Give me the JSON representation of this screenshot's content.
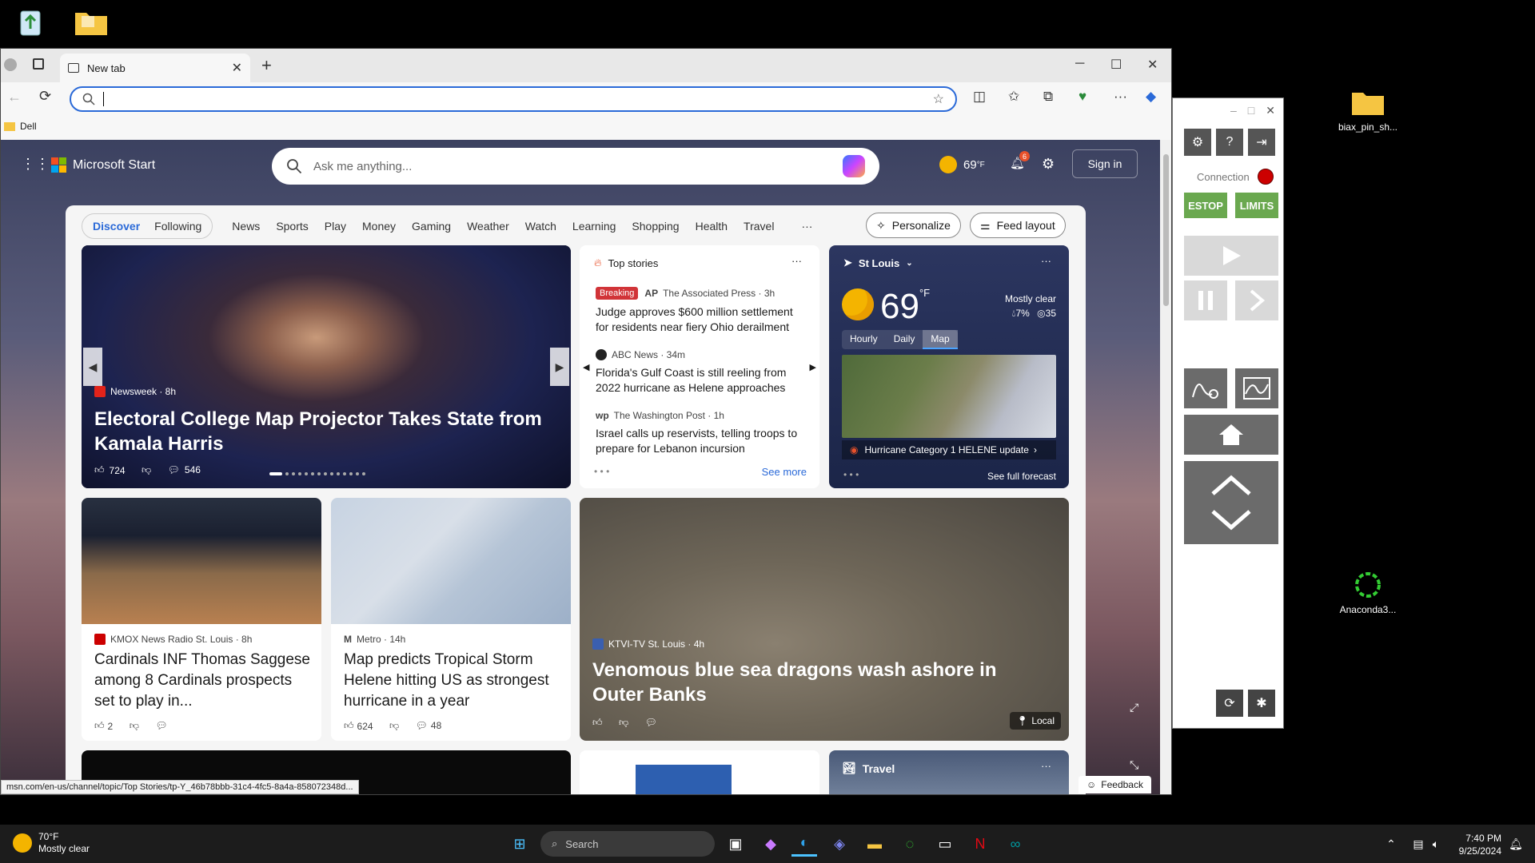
{
  "desktop": {
    "icons": [
      {
        "label": ""
      },
      {
        "label": ""
      },
      {
        "label": "biax_pin_sh..."
      },
      {
        "label": "Anaconda3..."
      }
    ]
  },
  "browser": {
    "tab_title": "New tab",
    "address_value": "",
    "favorites": [
      "Dell"
    ],
    "status_url": "msn.com/en-us/channel/topic/Top Stories/tp-Y_46b78bbb-31c4-4fc5-8a4a-858072348d..."
  },
  "msstart": {
    "brand": "Microsoft Start",
    "search_placeholder": "Ask me anything...",
    "weather_temp": "69",
    "weather_unit": "°F",
    "notif_count": "6",
    "sign_in": "Sign in",
    "nav_pill": [
      "Discover",
      "Following"
    ],
    "nav_items": [
      "News",
      "Sports",
      "Play",
      "Money",
      "Gaming",
      "Weather",
      "Watch",
      "Learning",
      "Shopping",
      "Health",
      "Travel"
    ],
    "more": "···",
    "personalize": "Personalize",
    "feed_layout": "Feed layout",
    "feedback": "Feedback"
  },
  "hero": {
    "source": "Newsweek · 8h",
    "title": "Electoral College Map Projector Takes State from Kamala Harris",
    "likes": "724",
    "comments": "546"
  },
  "top_stories": {
    "heading": "Top stories",
    "see_more": "See more",
    "items": [
      {
        "badge": "Breaking",
        "source": "The Associated Press · 3h",
        "title": "Judge approves $600 million settlement for residents near fiery Ohio derailment"
      },
      {
        "badge": "",
        "source": "ABC News · 34m",
        "title": "Florida's Gulf Coast is still reeling from 2022 hurricane as Helene approaches"
      },
      {
        "badge": "",
        "source": "The Washington Post · 1h",
        "title": "Israel calls up reservists, telling troops to prepare for Lebanon incursion"
      }
    ]
  },
  "weather": {
    "location": "St Louis",
    "temp": "69",
    "unit": "°F",
    "condition": "Mostly clear",
    "precip": "7%",
    "aqi": "35",
    "tabs": [
      "Hourly",
      "Daily",
      "Map"
    ],
    "alert": "Hurricane Category 1 HELENE update",
    "see_forecast": "See full forecast"
  },
  "cards": [
    {
      "source": "KMOX News Radio St. Louis · 8h",
      "title": "Cardinals INF Thomas Saggese among 8 Cardinals prospects set to play in...",
      "likes": "2",
      "comments": ""
    },
    {
      "source": "Metro · 14h",
      "title": "Map predicts Tropical Storm Helene hitting US as strongest hurricane in a year",
      "likes": "624",
      "comments": "48"
    },
    {
      "source": "KTVI-TV St. Louis · 4h",
      "title": "Venomous blue sea dragons wash ashore in Outer Banks",
      "local": "Local"
    }
  ],
  "travel_card": {
    "label": "Travel"
  },
  "side_panel": {
    "connection": "Connection",
    "estop": "ESTOP",
    "limits": "LIMITS"
  },
  "taskbar": {
    "weather_temp": "70°F",
    "weather_cond": "Mostly clear",
    "search": "Search",
    "time": "7:40 PM",
    "date": "9/25/2024"
  }
}
